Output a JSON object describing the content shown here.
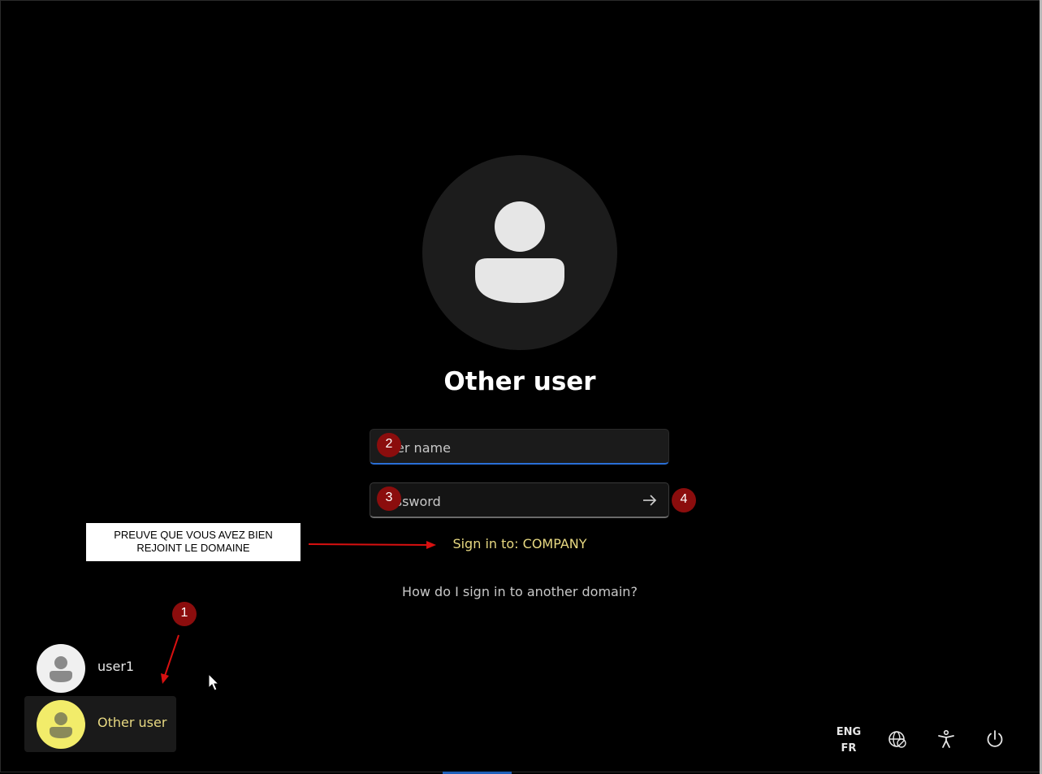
{
  "main": {
    "title": "Other user",
    "username_placeholder": "User name",
    "password_placeholder": "Password",
    "sign_in_to": "Sign in to: COMPANY",
    "how_link": "How do I sign in to another domain?"
  },
  "annotations": {
    "badge_1": "1",
    "badge_2": "2",
    "badge_3": "3",
    "badge_4": "4",
    "note_line1": "PREUVE QUE VOUS AVEZ BIEN",
    "note_line2": "REJOINT LE DOMAINE",
    "color": "#8b0d0d"
  },
  "user_list": [
    {
      "name": "user1"
    },
    {
      "name": "Other user"
    }
  ],
  "tray": {
    "lang_primary": "ENG",
    "lang_secondary": "FR",
    "icons": [
      "network-icon",
      "accessibility-icon",
      "power-icon"
    ]
  },
  "colors": {
    "accent_blue": "#2a6fd6",
    "highlight_yellow": "#e8d982",
    "selected_avatar": "#f2ec6a"
  }
}
